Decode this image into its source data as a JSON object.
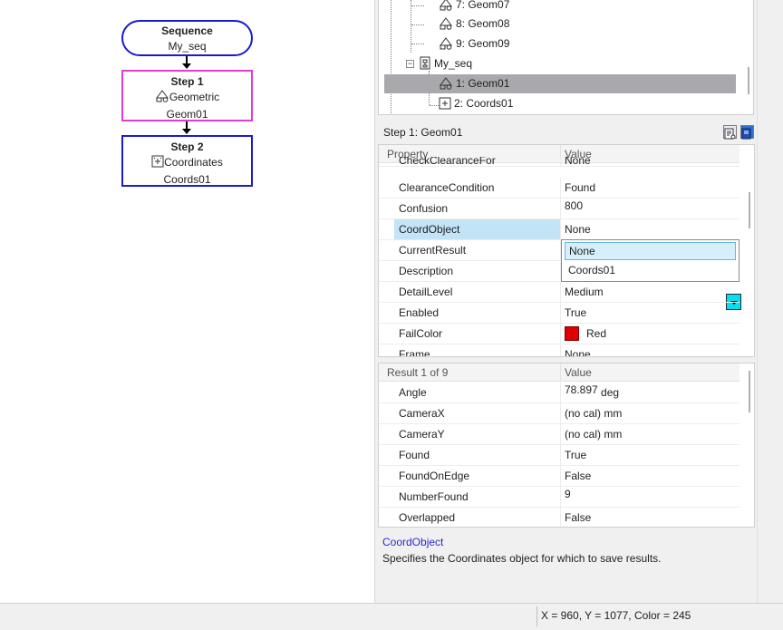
{
  "flowchart": {
    "sequence": {
      "title": "Sequence",
      "name": "My_seq"
    },
    "step1": {
      "title": "Step 1",
      "type": "Geometric",
      "name": "Geom01"
    },
    "step2": {
      "title": "Step 2",
      "type": "Coordinates",
      "name": "Coords01"
    }
  },
  "tree": {
    "items": [
      {
        "label": "7: Geom07",
        "icon": "geometric-icon"
      },
      {
        "label": "8: Geom08",
        "icon": "geometric-icon"
      },
      {
        "label": "9: Geom09",
        "icon": "geometric-icon"
      },
      {
        "label": "My_seq",
        "icon": "sequence-icon"
      },
      {
        "label": "1: Geom01",
        "icon": "geometric-icon",
        "selected": true
      },
      {
        "label": "2: Coords01",
        "icon": "coordinates-icon"
      }
    ]
  },
  "step_header": {
    "title": "Step 1: Geom01"
  },
  "properties": {
    "col_property": "Property",
    "col_value": "Value",
    "rows": [
      {
        "name": "CheckClearanceFor",
        "value": "None"
      },
      {
        "name": "ClearanceCondition",
        "value": "Found"
      },
      {
        "name": "Confusion",
        "value": "800"
      },
      {
        "name": "CoordObject",
        "value": "None",
        "selected": true
      },
      {
        "name": "CurrentResult",
        "value": ""
      },
      {
        "name": "Description",
        "value": ""
      },
      {
        "name": "DetailLevel",
        "value": "Medium"
      },
      {
        "name": "Enabled",
        "value": "True"
      },
      {
        "name": "FailColor",
        "value": "Red",
        "color": "#e00000"
      },
      {
        "name": "Frame",
        "value": "None"
      }
    ]
  },
  "dropdown": {
    "options": [
      "None",
      "Coords01"
    ],
    "highlighted": "None"
  },
  "results": {
    "col_result": "Result 1 of 9",
    "col_value": "Value",
    "rows": [
      {
        "name": "Angle",
        "value": "78.897",
        "unit": "deg"
      },
      {
        "name": "CameraX",
        "value": "(no cal) mm"
      },
      {
        "name": "CameraY",
        "value": "(no cal) mm"
      },
      {
        "name": "Found",
        "value": "True"
      },
      {
        "name": "FoundOnEdge",
        "value": "False"
      },
      {
        "name": "NumberFound",
        "value": "9"
      },
      {
        "name": "Overlapped",
        "value": "False"
      }
    ]
  },
  "description": {
    "title": "CoordObject",
    "text": "Specifies the Coordinates object for which to save results."
  },
  "status_bar": {
    "text": "X = 960, Y = 1077, Color = 245"
  }
}
